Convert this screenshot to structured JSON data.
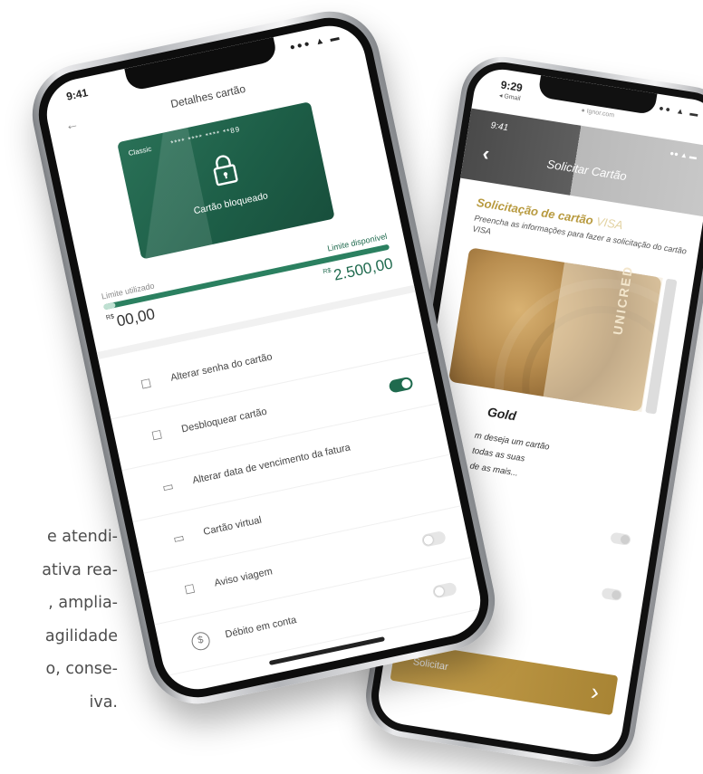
{
  "paragraph": {
    "lines": [
      "e atendi-",
      "ativa rea-",
      ", amplia-",
      "agilidade",
      "o, conse-",
      "iva."
    ]
  },
  "front_phone": {
    "status_time": "9:41",
    "status_icons": "●●● ▲ ▬",
    "back_icon": "←",
    "title": "Detalhes cartão",
    "card": {
      "type": "Classic",
      "number": "**** **** **** **89",
      "status": "Cartão bloqueado",
      "color": "#1d5e47"
    },
    "limits": {
      "used_label": "Limite utilizado",
      "available_label": "Limite disponível",
      "currency": "R$",
      "used_value": "00,00",
      "available_value": "2.500,00",
      "used_fraction": 0.0
    },
    "menu": [
      {
        "icon": "lock-icon",
        "glyph": "☐",
        "label": "Alterar senha do cartão",
        "toggle": null
      },
      {
        "icon": "unlock-icon",
        "glyph": "☐",
        "label": "Desbloquear cartão",
        "toggle": "on"
      },
      {
        "icon": "calendar-icon",
        "glyph": "▭",
        "label": "Alterar data de vencimento da fatura",
        "toggle": null
      },
      {
        "icon": "credit-card-icon",
        "glyph": "▭",
        "label": "Cartão virtual",
        "toggle": null
      },
      {
        "icon": "luggage-icon",
        "glyph": "☐",
        "label": "Aviso viagem",
        "toggle": "off"
      },
      {
        "icon": "dollar-circle-icon",
        "glyph": "$",
        "label": "Débito em conta",
        "toggle": "off"
      }
    ],
    "accent": "#1f6a4e"
  },
  "back_phone": {
    "status_time": "9:29",
    "browser_back": "◂ Gmail",
    "url": "● Ignor.com",
    "status_icons": "●● ▲ ▬",
    "inner_time": "9:41",
    "inner_icons": "●● ▲ ▬",
    "back_icon": "‹",
    "title": "Solicitar Cartão",
    "heading": "Solicitação de cartão",
    "heading_brand": "VISA",
    "subtitle": "Preencha as informações para fazer a solicitação do cartão VISA",
    "card_brand": "UNICRED",
    "card_name": "Gold",
    "description_lines": [
      "m deseja um cartão",
      "todas as suas",
      "de as mais..."
    ],
    "button_label": "Solicitar",
    "button_chevron": "›",
    "accent": "#b89a3f"
  }
}
